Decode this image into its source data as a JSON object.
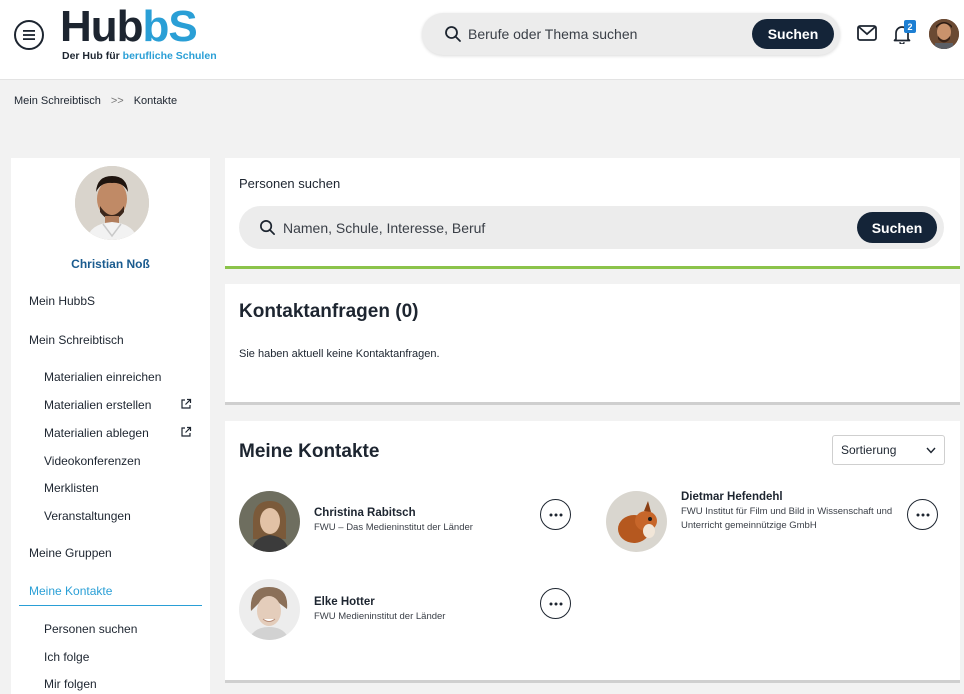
{
  "header": {
    "logo_main": "Hub",
    "logo_accent": "bS",
    "logo_tagline_a": "Der Hub für ",
    "logo_tagline_b": "berufliche Schulen",
    "search_placeholder": "Berufe oder Thema suchen",
    "search_button": "Suchen",
    "notification_count": "2"
  },
  "breadcrumb": {
    "items": [
      "Mein Schreibtisch",
      "Kontakte"
    ],
    "separator": ">>"
  },
  "sidebar": {
    "user_name": "Christian Noß",
    "items": [
      {
        "label": "Mein HubbS"
      },
      {
        "label": "Mein Schreibtisch"
      },
      {
        "label": "Materialien einreichen"
      },
      {
        "label": "Materialien erstellen"
      },
      {
        "label": "Materialien ablegen"
      },
      {
        "label": "Videokonferenzen"
      },
      {
        "label": "Merklisten"
      },
      {
        "label": "Veranstaltungen"
      },
      {
        "label": "Meine Gruppen"
      },
      {
        "label": "Meine Kontakte"
      },
      {
        "label": "Personen suchen"
      },
      {
        "label": "Ich folge"
      },
      {
        "label": "Mir folgen"
      }
    ]
  },
  "people_search": {
    "label": "Personen suchen",
    "placeholder": "Namen, Schule, Interesse, Beruf",
    "button": "Suchen"
  },
  "requests": {
    "title": "Kontaktanfragen (0)",
    "empty_text": "Sie haben aktuell keine Kontaktanfragen."
  },
  "contacts": {
    "title": "Meine Kontakte",
    "sort_label": "Sortierung",
    "items": [
      {
        "name": "Christina Rabitsch",
        "org": "FWU – Das Medieninstitut der Länder"
      },
      {
        "name": "Dietmar Hefendehl",
        "org": "FWU Institut für Film und Bild in Wissenschaft und Unterricht gemeinnützige GmbH"
      },
      {
        "name": "Elke Hotter",
        "org": "FWU Medieninstitut der Länder"
      }
    ]
  },
  "colors": {
    "accent": "#2a9fd6",
    "dark_button": "#142438",
    "green_rule": "#8bc34a"
  }
}
